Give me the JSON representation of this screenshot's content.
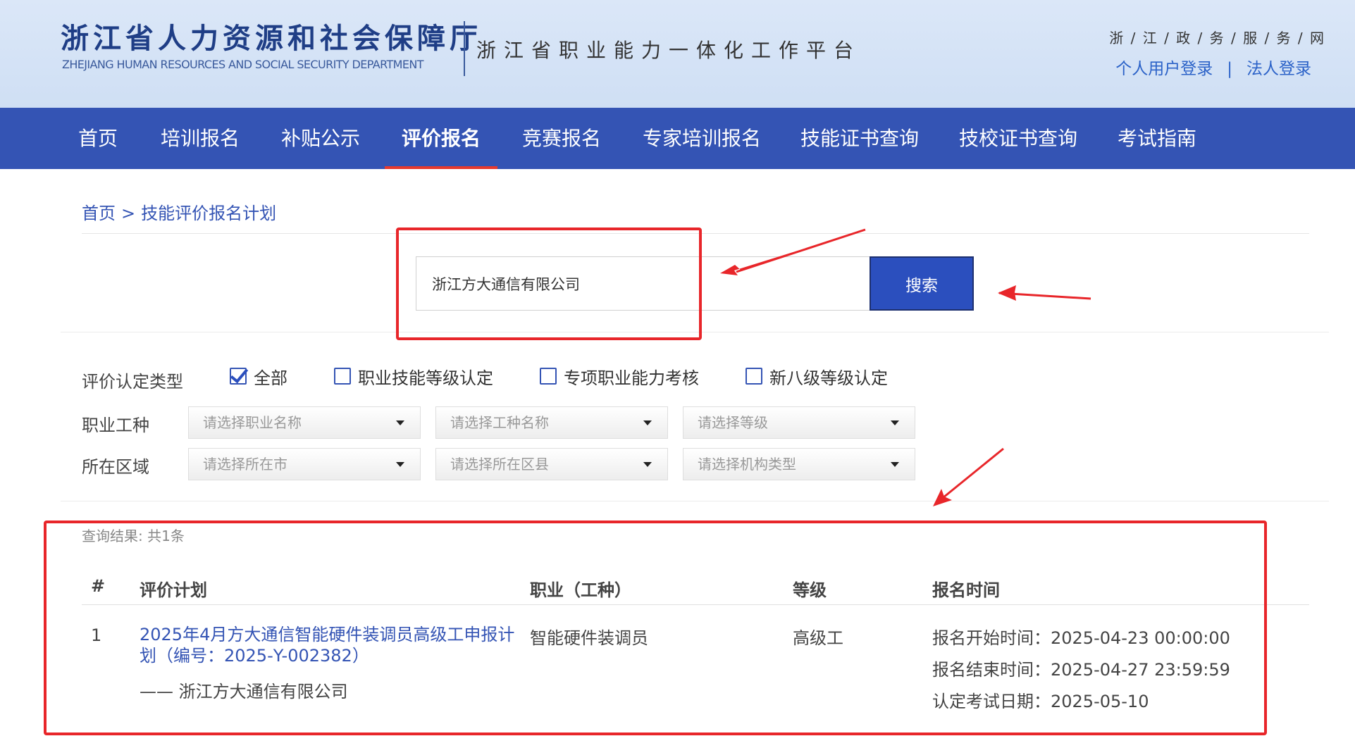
{
  "header": {
    "dept_cn": "浙江省人力资源和社会保障厅",
    "dept_en": "ZHEJIANG HUMAN RESOURCES AND SOCIAL SECURITY DEPARTMENT",
    "platform": "浙江省职业能力一体化工作平台",
    "gov_link": "浙 / 江 / 政 / 务 / 服 / 务 / 网",
    "personal_login": "个人用户登录",
    "separator": "|",
    "legal_login": "法人登录",
    "title_color": "#1f3e86",
    "link_color": "#2b62c8"
  },
  "nav": {
    "items": [
      "首页",
      "培训报名",
      "补贴公示",
      "评价报名",
      "竞赛报名",
      "专家培训报名",
      "技能证书查询",
      "技校证书查询",
      "考试指南"
    ],
    "active": "评价报名",
    "bg_color": "#3454b4",
    "active_underline_color": "#e63a2e"
  },
  "breadcrumb": {
    "home": "首页",
    "separator": ">",
    "current": "技能评价报名计划"
  },
  "search": {
    "value": "浙江方大通信有限公司",
    "button": "搜索",
    "button_color": "#2b4fbe"
  },
  "filters": {
    "type_label": "评价认定类型",
    "types": [
      {
        "label": "全部",
        "checked": true
      },
      {
        "label": "职业技能等级认定",
        "checked": false
      },
      {
        "label": "专项职业能力考核",
        "checked": false
      },
      {
        "label": "新八级等级认定",
        "checked": false
      }
    ],
    "occupation_label": "职业工种",
    "occupation_selects": [
      "请选择职业名称",
      "请选择工种名称",
      "请选择等级"
    ],
    "region_label": "所在区域",
    "region_selects": [
      "请选择所在市",
      "请选择所在区县",
      "请选择机构类型"
    ]
  },
  "results": {
    "count_text": "查询结果: 共1条",
    "headers": [
      "#",
      "评价计划",
      "职业（工种）",
      "等级",
      "报名时间"
    ],
    "rows": [
      {
        "index": "1",
        "plan": "2025年4月方大通信智能硬件装调员高级工申报计划（编号：2025-Y-002382）",
        "org": "—— 浙江方大通信有限公司",
        "occupation": "智能硬件装调员",
        "level": "高级工",
        "start": "报名开始时间：2025-04-23 00:00:00",
        "end": "报名结束时间：2025-04-27 23:59:59",
        "exam": "认定考试日期：2025-05-10"
      }
    ]
  },
  "annotation_color": "#e8262a"
}
